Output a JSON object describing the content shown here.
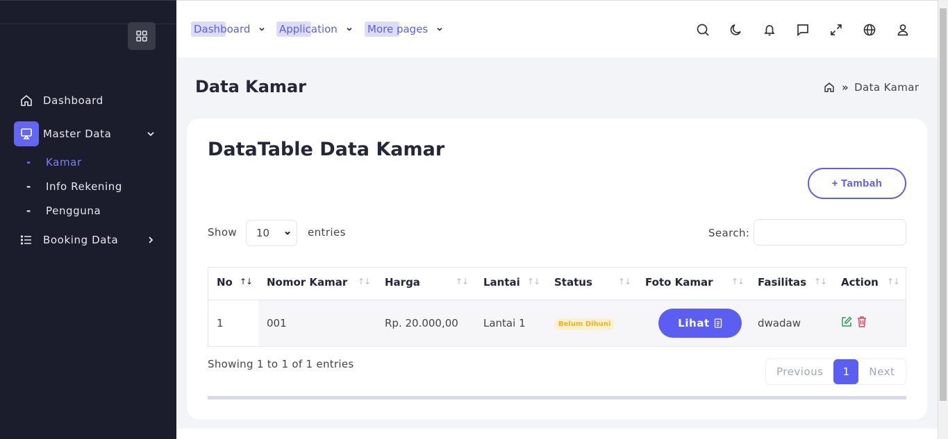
{
  "sidebar": {
    "menu": [
      {
        "label": "Dashboard",
        "icon": "home-icon"
      },
      {
        "label": "Master Data",
        "icon": "monitor-icon"
      },
      {
        "label": "Booking Data",
        "icon": "list-icon"
      }
    ],
    "sub_items": [
      {
        "label": "Kamar",
        "dash": "-"
      },
      {
        "label": "Info Rekening",
        "dash": "-"
      },
      {
        "label": "Pengguna",
        "dash": "-"
      }
    ]
  },
  "topnav": [
    {
      "label": "Dashboard"
    },
    {
      "label": "Application"
    },
    {
      "label": "More pages"
    }
  ],
  "page": {
    "title": "Data Kamar",
    "breadcrumb": "Data Kamar"
  },
  "card": {
    "title": "DataTable Data Kamar",
    "add_button": "Tambah",
    "add_button_icon": "+",
    "show_label": "Show",
    "entries_label": "entries",
    "page_size": "10",
    "search_label": "Search:",
    "info": "Showing 1 to 1 of 1 entries",
    "pager": {
      "prev": "Previous",
      "current": "1",
      "next": "Next"
    }
  },
  "table": {
    "headers": [
      "No",
      "Nomor Kamar",
      "Harga",
      "Lantai",
      "Status",
      "Foto Kamar",
      "Fasilitas",
      "Action"
    ],
    "sort_symbol": "↑↓",
    "rows": [
      {
        "no": "1",
        "nomor": "001",
        "harga": "Rp. 20.000,00",
        "lantai": "Lantai 1",
        "status": "Belum Dihuni",
        "foto": "Lihat",
        "fasilitas": "dwadaw"
      }
    ]
  },
  "colors": {
    "accent": "#5b5ef0",
    "sidebar_bg": "#1b1c2c",
    "status_warning": "#f2b21b",
    "edit": "#22a35a",
    "delete": "#e5405e"
  }
}
